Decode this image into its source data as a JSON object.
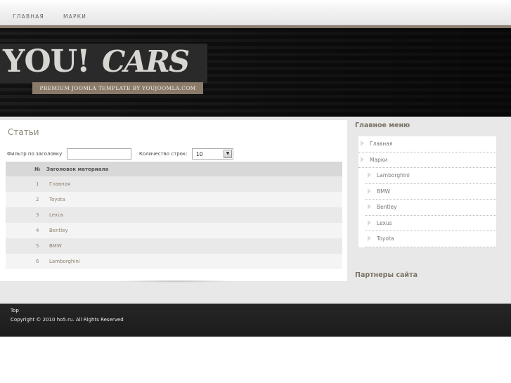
{
  "nav": {
    "home": "ГЛАВНАЯ",
    "brands": "МАРКИ"
  },
  "logo": {
    "you": "YOU!",
    "cars": "CARS",
    "tagline": "PREMIUM JOOMLA TEMPLATE BY YOUJOOMLA.COM"
  },
  "main": {
    "title": "Статьи",
    "filter_label": "Фильтр по заголовку",
    "filter_value": "",
    "rows_label": "Количество строк:",
    "rows_value": "10",
    "table": {
      "col_num": "№",
      "col_title": "Заголовок материала",
      "rows": [
        {
          "num": "1",
          "title": "Главная"
        },
        {
          "num": "2",
          "title": "Toyota"
        },
        {
          "num": "3",
          "title": "Lexus"
        },
        {
          "num": "4",
          "title": "Bentley"
        },
        {
          "num": "5",
          "title": "BMW"
        },
        {
          "num": "6",
          "title": "Lamborghini"
        }
      ]
    }
  },
  "sidebar": {
    "menu_title": "Главное меню",
    "items": [
      {
        "label": "Главная"
      },
      {
        "label": "Марки"
      },
      {
        "label": "Lamborghini"
      },
      {
        "label": "BMW"
      },
      {
        "label": "Bentley"
      },
      {
        "label": "Lexus"
      },
      {
        "label": "Toyota"
      }
    ],
    "partners_title": "Партнеры сайта"
  },
  "footer": {
    "top": "Top",
    "copyright": "Copyright © 2010 ho5.ru.   All Rights Reserved"
  },
  "colors": {
    "accent_brown": "#8a7a6a",
    "link": "#8d7e6c",
    "header_bg": "#151515"
  }
}
